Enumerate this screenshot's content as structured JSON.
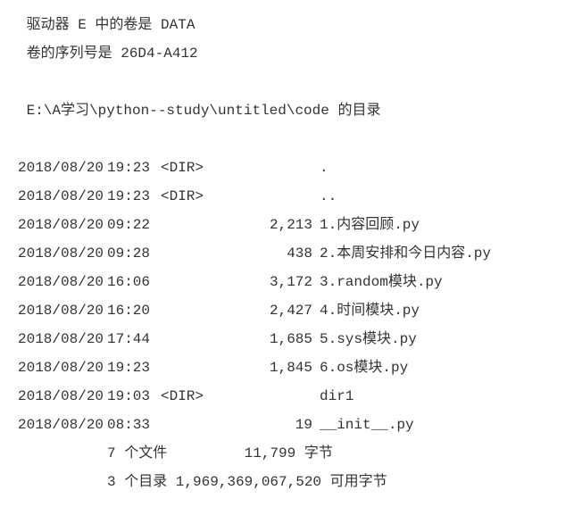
{
  "header": {
    "volume_line": " 驱动器 E 中的卷是 DATA",
    "serial_line": " 卷的序列号是 26D4-A412",
    "path_line": " E:\\A学习\\python--study\\untitled\\code 的目录"
  },
  "entries": [
    {
      "date": "2018/08/20",
      "time": "19:23",
      "dir": "<DIR>",
      "size": "",
      "name": "."
    },
    {
      "date": "2018/08/20",
      "time": "19:23",
      "dir": "<DIR>",
      "size": "",
      "name": ".."
    },
    {
      "date": "2018/08/20",
      "time": "09:22",
      "dir": "",
      "size": "2,213",
      "name": "1.内容回顾.py"
    },
    {
      "date": "2018/08/20",
      "time": "09:28",
      "dir": "",
      "size": "438",
      "name": "2.本周安排和今日内容.py"
    },
    {
      "date": "2018/08/20",
      "time": "16:06",
      "dir": "",
      "size": "3,172",
      "name": "3.random模块.py"
    },
    {
      "date": "2018/08/20",
      "time": "16:20",
      "dir": "",
      "size": "2,427",
      "name": "4.时间模块.py"
    },
    {
      "date": "2018/08/20",
      "time": "17:44",
      "dir": "",
      "size": "1,685",
      "name": "5.sys模块.py"
    },
    {
      "date": "2018/08/20",
      "time": "19:23",
      "dir": "",
      "size": "1,845",
      "name": "6.os模块.py"
    },
    {
      "date": "2018/08/20",
      "time": "19:03",
      "dir": "<DIR>",
      "size": "",
      "name": "dir1"
    },
    {
      "date": "2018/08/20",
      "time": "08:33",
      "dir": "",
      "size": "19",
      "name": "__init__.py"
    }
  ],
  "summary": {
    "files_line": "7 个文件         11,799 字节",
    "dirs_line": "3 个目录 1,969,369,067,520 可用字节"
  }
}
